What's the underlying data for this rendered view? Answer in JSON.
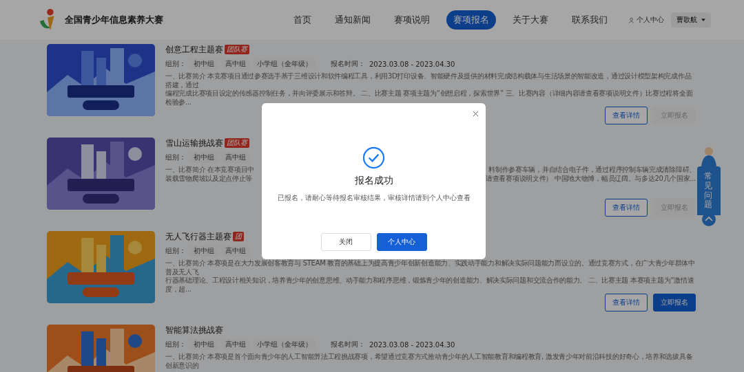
{
  "header": {
    "logo_text": "全国青少年信息素养大赛",
    "nav": [
      {
        "label": "首页",
        "selected": false
      },
      {
        "label": "通知新闻",
        "selected": false
      },
      {
        "label": "赛项说明",
        "selected": false
      },
      {
        "label": "赛项报名",
        "selected": true
      },
      {
        "label": "关于大赛",
        "selected": false
      },
      {
        "label": "联系我们",
        "selected": false
      }
    ],
    "user_center": "个人中心",
    "user_name": "曹歌航"
  },
  "cards": [
    {
      "title": "创意工程主题赛",
      "badge": "团队赛",
      "groups_label": "组别：",
      "groups": [
        "初中组",
        "高中组",
        "小学组（全年级）"
      ],
      "time_label": "报名时间：",
      "time": "2023.03.08 - 2023.04.30",
      "lines": [
        {
          "left": "一、比赛简介 本竞赛项目通过参赛选手基于三维设计和软件编程工具，利用3D打印设备、智能硬件及提供的材料完成结构载体与生活场景的智能改造，通过设计模型架构完成作品搭建，通过"
        },
        {
          "left": "编程完成比赛项目设定的传感器控制任务，并向评委展示和答辩。 二、比赛主题 赛项主题为“创想启程，探索世界” 三、比赛内容（详细内容请查看赛项说明文件）比赛过程将全面检验参..."
        }
      ],
      "buttons": [
        {
          "label": "查看详情",
          "kind": "outline"
        },
        {
          "label": "立即报名",
          "kind": "disabled"
        }
      ]
    },
    {
      "title": "雪山运输挑战赛",
      "badge": "团队赛",
      "groups_label": "组别：",
      "groups": [
        "初中组",
        "高中组"
      ],
      "lines": [
        {
          "left": "一、比赛简介 在本竞赛项目中",
          "right": "料制作参赛车辆，并自结合电子件，通过程序控制车辆完成清除障碍、"
        },
        {
          "left": "装载雪物爬坡以及定点停止等",
          "right": "请查看赛项说明文件） 中国地大物博，幅员辽阔。与多达20几个国家..."
        }
      ],
      "buttons": [
        {
          "label": "查看详情",
          "kind": "outline"
        },
        {
          "label": "立即报名",
          "kind": "disabled"
        }
      ]
    },
    {
      "title": "无人飞行器主题赛",
      "badge": "团",
      "groups_label": "组别：",
      "groups": [
        "初中组",
        "高中组"
      ],
      "lines": [
        {
          "left": "一、比赛简介 本赛项是在大力发展创客教育与 STEAM 教育的基础上为提高青少年创新创造能力、实践动手能力和解决实际问题能力而设立的。通过竞赛方式，在广大青少年群体中普及无人飞"
        },
        {
          "left": "行器基础理论、工程设计相关知识，培养青少年的创意思维、动手能力和程序思维，锻炼青少年的创造能力、解决实际问题和交流合作的能力。 二、比赛主题 本赛项主题为“激情速度，超..."
        }
      ],
      "buttons": [
        {
          "label": "查看详情",
          "kind": "outline"
        },
        {
          "label": "立即报名",
          "kind": "primary"
        }
      ]
    },
    {
      "title": "智能算法挑战赛",
      "groups_label": "组别：",
      "groups": [
        "初中组",
        "高中组",
        "小学组（全年级）"
      ],
      "time_label": "报名时间：",
      "time": "2023.03.08 - 2023.04.30",
      "lines": [
        {
          "left": "一、比赛简介 本赛项是首个面向青少年的人工智能算法工程挑战赛项，希望通过竞赛方式推动青少年的人工智能教育和编程教育, 激发青少年对前沿科技的好奇心，培养和选拔具备创新意识的"
        }
      ]
    }
  ],
  "side_tab": {
    "label": "常见问题"
  },
  "modal": {
    "title": "报名成功",
    "message": "已报名，请耐心等待报名审核结果，审核详情请到个人中心查看",
    "buttons": [
      {
        "label": "关闭",
        "kind": "default"
      },
      {
        "label": "个人中心",
        "kind": "primary"
      }
    ]
  }
}
